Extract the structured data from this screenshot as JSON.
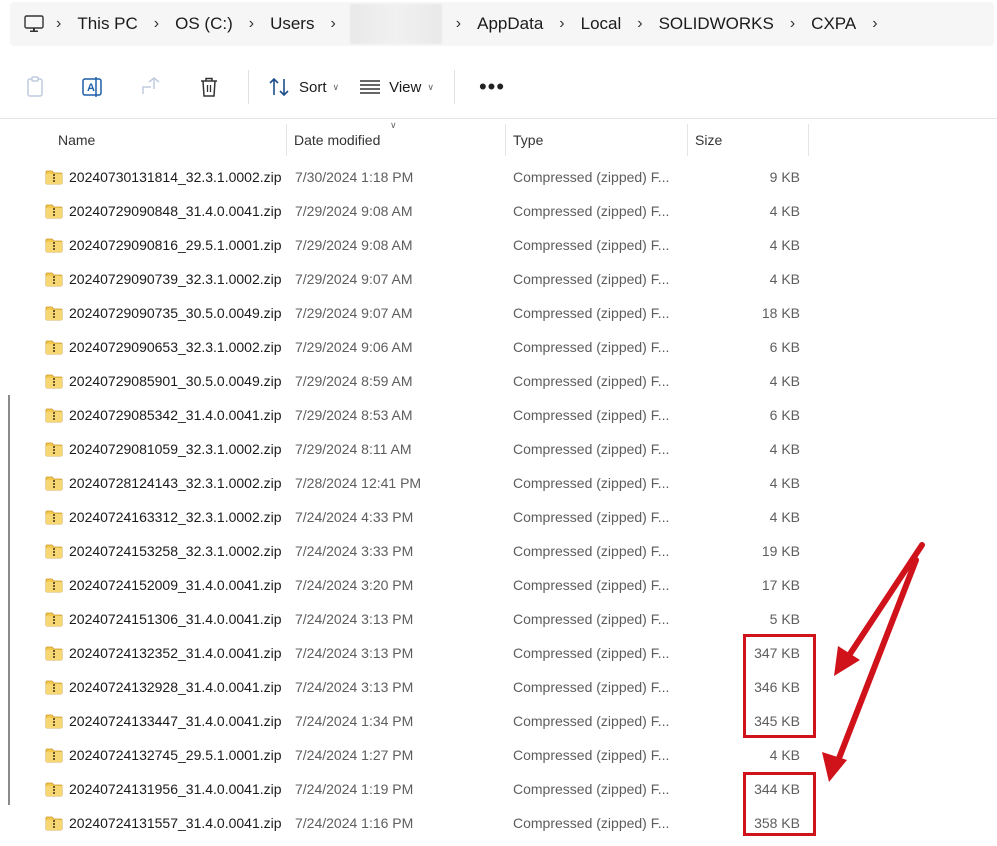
{
  "breadcrumb": {
    "items": [
      {
        "label": "This PC"
      },
      {
        "label": "OS (C:)"
      },
      {
        "label": "Users"
      },
      {
        "label": ""
      },
      {
        "label": "AppData"
      },
      {
        "label": "Local"
      },
      {
        "label": "SOLIDWORKS"
      },
      {
        "label": "CXPA"
      }
    ]
  },
  "toolbar": {
    "sort_label": "Sort",
    "view_label": "View",
    "more_label": "•••"
  },
  "columns": {
    "name": "Name",
    "date": "Date modified",
    "type": "Type",
    "size": "Size"
  },
  "files": [
    {
      "name": "20240730131814_32.3.1.0002.zip",
      "date": "7/30/2024 1:18 PM",
      "type": "Compressed (zipped) F...",
      "size": "9 KB"
    },
    {
      "name": "20240729090848_31.4.0.0041.zip",
      "date": "7/29/2024 9:08 AM",
      "type": "Compressed (zipped) F...",
      "size": "4 KB"
    },
    {
      "name": "20240729090816_29.5.1.0001.zip",
      "date": "7/29/2024 9:08 AM",
      "type": "Compressed (zipped) F...",
      "size": "4 KB"
    },
    {
      "name": "20240729090739_32.3.1.0002.zip",
      "date": "7/29/2024 9:07 AM",
      "type": "Compressed (zipped) F...",
      "size": "4 KB"
    },
    {
      "name": "20240729090735_30.5.0.0049.zip",
      "date": "7/29/2024 9:07 AM",
      "type": "Compressed (zipped) F...",
      "size": "18 KB"
    },
    {
      "name": "20240729090653_32.3.1.0002.zip",
      "date": "7/29/2024 9:06 AM",
      "type": "Compressed (zipped) F...",
      "size": "6 KB"
    },
    {
      "name": "20240729085901_30.5.0.0049.zip",
      "date": "7/29/2024 8:59 AM",
      "type": "Compressed (zipped) F...",
      "size": "4 KB"
    },
    {
      "name": "20240729085342_31.4.0.0041.zip",
      "date": "7/29/2024 8:53 AM",
      "type": "Compressed (zipped) F...",
      "size": "6 KB"
    },
    {
      "name": "20240729081059_32.3.1.0002.zip",
      "date": "7/29/2024 8:11 AM",
      "type": "Compressed (zipped) F...",
      "size": "4 KB"
    },
    {
      "name": "20240728124143_32.3.1.0002.zip",
      "date": "7/28/2024 12:41 PM",
      "type": "Compressed (zipped) F...",
      "size": "4 KB"
    },
    {
      "name": "20240724163312_32.3.1.0002.zip",
      "date": "7/24/2024 4:33 PM",
      "type": "Compressed (zipped) F...",
      "size": "4 KB"
    },
    {
      "name": "20240724153258_32.3.1.0002.zip",
      "date": "7/24/2024 3:33 PM",
      "type": "Compressed (zipped) F...",
      "size": "19 KB"
    },
    {
      "name": "20240724152009_31.4.0.0041.zip",
      "date": "7/24/2024 3:20 PM",
      "type": "Compressed (zipped) F...",
      "size": "17 KB"
    },
    {
      "name": "20240724151306_31.4.0.0041.zip",
      "date": "7/24/2024 3:13 PM",
      "type": "Compressed (zipped) F...",
      "size": "5 KB"
    },
    {
      "name": "20240724132352_31.4.0.0041.zip",
      "date": "7/24/2024 3:13 PM",
      "type": "Compressed (zipped) F...",
      "size": "347 KB"
    },
    {
      "name": "20240724132928_31.4.0.0041.zip",
      "date": "7/24/2024 3:13 PM",
      "type": "Compressed (zipped) F...",
      "size": "346 KB"
    },
    {
      "name": "20240724133447_31.4.0.0041.zip",
      "date": "7/24/2024 1:34 PM",
      "type": "Compressed (zipped) F...",
      "size": "345 KB"
    },
    {
      "name": "20240724132745_29.5.1.0001.zip",
      "date": "7/24/2024 1:27 PM",
      "type": "Compressed (zipped) F...",
      "size": "4 KB"
    },
    {
      "name": "20240724131956_31.4.0.0041.zip",
      "date": "7/24/2024 1:19 PM",
      "type": "Compressed (zipped) F...",
      "size": "344 KB"
    },
    {
      "name": "20240724131557_31.4.0.0041.zip",
      "date": "7/24/2024 1:16 PM",
      "type": "Compressed (zipped) F...",
      "size": "358 KB"
    }
  ],
  "icons": {
    "pc": "computer-icon",
    "copy": "clipboard-icon",
    "rename": "rename-icon",
    "share": "share-icon",
    "delete": "trash-icon",
    "sort": "sort-icon",
    "view": "view-icon",
    "zip": "zip-folder-icon"
  },
  "colors": {
    "annotation": "#d0121b",
    "zip_folder": "#f2c94c"
  }
}
